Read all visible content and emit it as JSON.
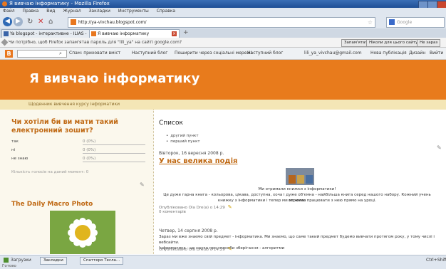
{
  "window": {
    "title": "Я вивчаю інформатику - Mozilla Firefox"
  },
  "menu": [
    "Файл",
    "Правка",
    "Вид",
    "Журнал",
    "Закладки",
    "Инструменты",
    "Справка"
  ],
  "nav": {
    "url": "http://ya-vivchau.blogspot.com/",
    "search_placeholder": "Google"
  },
  "tabs": [
    {
      "label": "Ya blogspot - інтерактивне - ILIAS - Mozilla...",
      "active": false
    },
    {
      "label": "Я вивчаю інформатику",
      "active": true
    }
  ],
  "notification": {
    "text": "Чи потрібно, щоб Firefox запам'ятав пароль для \"lili_ya\" на сайті google.com?",
    "buttons": [
      "Запам'ятати",
      "Ніколи для цього сайту",
      "Не зараз"
    ]
  },
  "blogger": {
    "links": [
      "Спам: приховати вміст",
      "Наступний блог",
      "Поширити через соціальні мережі",
      "Наступний блог"
    ],
    "user": "lili_ya_vivchau@gmail.com",
    "right_links": [
      "Нова публікація",
      "Дизайн",
      "Вийти"
    ]
  },
  "blog": {
    "title": "Я вивчаю інформатику",
    "description": "Щоденник вивчення курсу інформатики"
  },
  "poll": {
    "question": "Чи хотіли би ви мати такий електронний зошит?",
    "options": [
      {
        "label": "так",
        "result": "0 (0%)"
      },
      {
        "label": "ні",
        "result": "0 (0%)"
      },
      {
        "label": "не знаю",
        "result": "0 (0%)"
      }
    ],
    "note": "Кількість голосів на даний момент: 0"
  },
  "daily_macro": {
    "title": "The Daily Macro Photo"
  },
  "list": {
    "title": "Список",
    "items": [
      "другий пункт",
      "перший пункт"
    ]
  },
  "posts": [
    {
      "date": "Вівторок, 16 вересня 2008 р.",
      "title": "У нас велика подія",
      "image_caption": "Ми отримали книжки з інформатики!",
      "body_line1": "Це дуже гарна книга - кольорова, цікава, доступна, хоча і дуже об'ємна - найбільша книга серед нашого набору. Кожний учень отримав",
      "body_line2": "книжку з інформатики і тепер ми можемо працювати з нею прямо на уроці.",
      "meta": "Опубліковано Ola Dre(a) o 14:29",
      "comments": "0 коментарів"
    },
    {
      "date": "Четвер, 14 серпня 2008 р.",
      "body_line1": "Зараз ми вже знаємо свій предмет - інформатика. Ми знаємо, що саме такий предмет будемо вивчати протягом року, у тому числі і вебсайти.",
      "body_line2": "Інформатика - це наука про способи зберігання - алгоритми",
      "meta": "Опубліковано Ola Dre(a) o 14:29"
    }
  ],
  "statusbar": {
    "items": [
      "Загрузки",
      "Закладки",
      "Спаттеро Тесла..."
    ],
    "status": "Готово",
    "right": "Ctrl+Shift"
  }
}
